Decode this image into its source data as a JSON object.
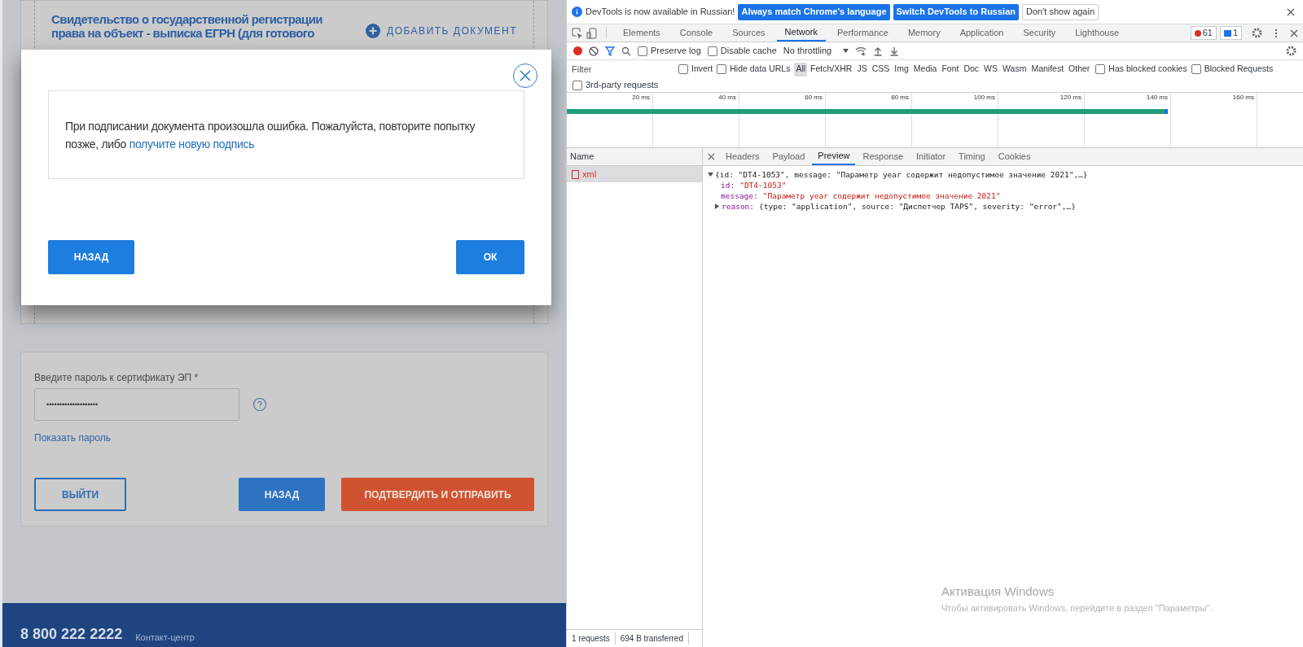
{
  "page": {
    "document_title": "Свидетельство о государственной регистрации права на объект - выписка ЕГРН (для готового",
    "add_document": "ДОБАВИТЬ ДОКУМЕНТ",
    "password_label": "Введите пароль к сертификату ЭП *",
    "password_value": "••••••••••••••••••••",
    "show_password": "Показать пароль",
    "buttons": [
      {
        "label": "ВЫЙТИ",
        "kind": "outline"
      },
      {
        "label": "НАЗАД",
        "kind": "primary"
      },
      {
        "label": "ПОДТВЕРДИТЬ И ОТПРАВИТЬ",
        "kind": "accent"
      }
    ],
    "footer": {
      "phone": "8 800 222 2222",
      "contact": "Контакт-центр"
    }
  },
  "modal": {
    "message": "При подписании документа произошла ошибка. Пожалуйста, повторите попытку позже, либо",
    "link": "получите новую подпись",
    "buttons": [
      {
        "label": "НАЗАД"
      },
      {
        "label": "ОК"
      }
    ]
  },
  "devtools": {
    "infobar": {
      "text": "DevTools is now available in Russian!",
      "buttons": [
        {
          "label": "Always match Chrome's language",
          "kind": "primary"
        },
        {
          "label": "Switch DevTools to Russian",
          "kind": "primary"
        },
        {
          "label": "Don't show again",
          "kind": "plain"
        }
      ]
    },
    "tabs": [
      {
        "label": "Elements",
        "selected": false
      },
      {
        "label": "Console",
        "selected": false
      },
      {
        "label": "Sources",
        "selected": false
      },
      {
        "label": "Network",
        "selected": true
      },
      {
        "label": "Performance",
        "selected": false
      },
      {
        "label": "Memory",
        "selected": false
      },
      {
        "label": "Application",
        "selected": false
      },
      {
        "label": "Security",
        "selected": false
      },
      {
        "label": "Lighthouse",
        "selected": false
      }
    ],
    "errors": "61",
    "messages": "1",
    "toolbar": {
      "preserve_log": {
        "label": "Preserve log",
        "checked": false
      },
      "disable_cache": {
        "label": "Disable cache",
        "checked": false
      },
      "throttling": "No throttling"
    },
    "filter": {
      "placeholder": "Filter",
      "invert": {
        "label": "Invert",
        "checked": false
      },
      "hide_data_urls": {
        "label": "Hide data URLs",
        "checked": false
      },
      "types": [
        {
          "label": "All",
          "selected": true
        },
        {
          "label": "Fetch/XHR",
          "selected": false
        },
        {
          "label": "JS",
          "selected": false
        },
        {
          "label": "CSS",
          "selected": false
        },
        {
          "label": "Img",
          "selected": false
        },
        {
          "label": "Media",
          "selected": false
        },
        {
          "label": "Font",
          "selected": false
        },
        {
          "label": "Doc",
          "selected": false
        },
        {
          "label": "WS",
          "selected": false
        },
        {
          "label": "Wasm",
          "selected": false
        },
        {
          "label": "Manifest",
          "selected": false
        },
        {
          "label": "Other",
          "selected": false
        }
      ],
      "has_blocked_cookies": {
        "label": "Has blocked cookies",
        "checked": false
      },
      "blocked_requests": {
        "label": "Blocked Requests",
        "checked": false
      },
      "third_party": {
        "label": "3rd-party requests",
        "checked": false
      }
    },
    "timeline_ticks": [
      "20 ms",
      "40 ms",
      "60 ms",
      "80 ms",
      "100 ms",
      "120 ms",
      "140 ms",
      "160 ms"
    ],
    "requests": {
      "header": "Name",
      "rows": [
        {
          "name": "xml",
          "selected": true
        }
      ]
    },
    "detail_tabs": [
      {
        "label": "Headers",
        "selected": false
      },
      {
        "label": "Payload",
        "selected": false
      },
      {
        "label": "Preview",
        "selected": true
      },
      {
        "label": "Response",
        "selected": false
      },
      {
        "label": "Initiator",
        "selected": false
      },
      {
        "label": "Timing",
        "selected": false
      },
      {
        "label": "Cookies",
        "selected": false
      }
    ],
    "preview": [
      {
        "kind": "summary",
        "expanded": true,
        "text": "{id: \"DT4-1053\", message: \"Параметр year содержит недопустимое значение 2021\",…}"
      },
      {
        "kind": "property",
        "key": "id:",
        "value": "\"DT4-1053\""
      },
      {
        "kind": "property",
        "key": "message:",
        "value": "\"Параметр year содержит недопустимое значение 2021\""
      },
      {
        "kind": "object",
        "expanded": false,
        "key": "reason:",
        "value": "{type: \"application\", source: \"Диспетчер TAPS\", severity: \"error\",…}"
      }
    ],
    "status": [
      "1 requests",
      "694 B transferred"
    ]
  },
  "windows_activation": {
    "title": "Активация Windows",
    "text": "Чтобы активировать Windows, перейдите в раздел \"Параметры\"."
  }
}
